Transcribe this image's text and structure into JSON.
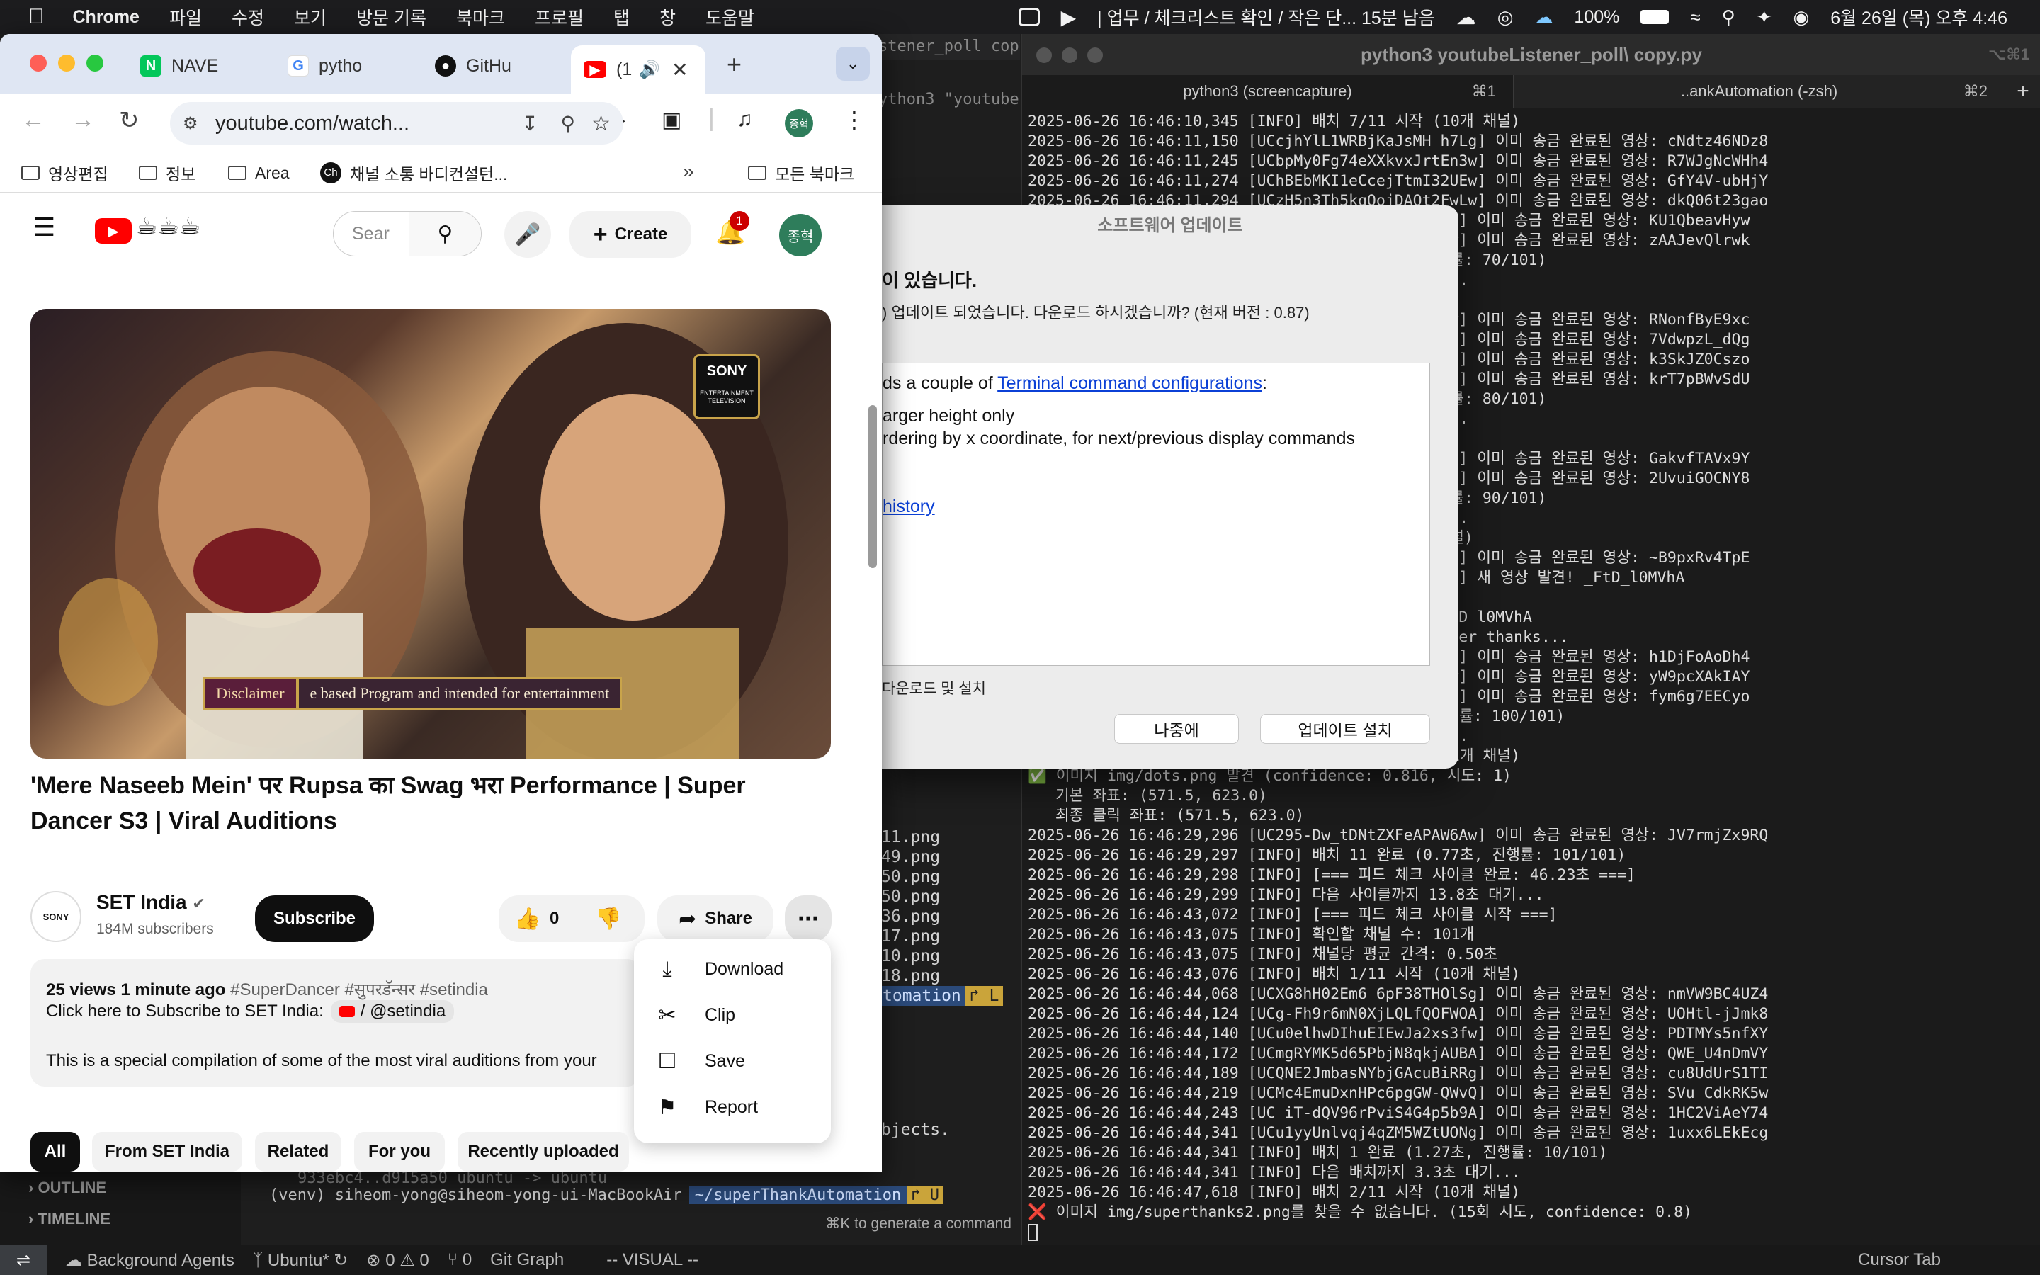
{
  "menubar": {
    "app": "Chrome",
    "items": [
      "파일",
      "수정",
      "보기",
      "방문 기록",
      "북마크",
      "프로필",
      "탭",
      "창",
      "도움말"
    ],
    "reminder": "업무 / 체크리스트 확인 / 작은 단... 15분 남음",
    "battery": "100%",
    "datetime": "6월 26일 (목) 오후 4:46"
  },
  "chrome": {
    "tabs": [
      {
        "label": "NAVE",
        "favicon": "N",
        "color": "#03c75a"
      },
      {
        "label": "pytho",
        "favicon": "G",
        "color": "#4285f4"
      },
      {
        "label": "GitHu",
        "favicon": "gh",
        "color": "#111111"
      },
      {
        "label": "(1",
        "favicon": "yt",
        "color": "#ff0000"
      }
    ],
    "url": "youtube.com/watch...",
    "profile_badge": "종혁",
    "bookmarks": [
      "영상편집",
      "정보",
      "Area",
      "채널 소통 바디컨설턴...",
      "모든 북마크"
    ]
  },
  "youtube": {
    "search_placeholder": "Sear",
    "create_label": "Create",
    "notif_count": "1",
    "avatar_label": "종혁",
    "video_title": "'Mere Naseeb Mein' पर Rupsa का Swag भरा Performance | Super Dancer S3 | Viral Auditions",
    "disclaimer_label": "Disclaimer",
    "disclaimer_text": "e based Program and intended for entertainment",
    "sony_logo": "SONY",
    "sony_sub": "ENTERTAINMENT TELEVISION",
    "channel_name": "SET India",
    "subscribers": "184M subscribers",
    "subscribe_label": "Subscribe",
    "like_count": "0",
    "share_label": "Share",
    "desc_meta": "25 views  1 minute ago",
    "desc_tags": "#SuperDancer #सुपरडॅन्सर #setindia",
    "desc_subscribe": "Click here to Subscribe to SET India:",
    "desc_handle": "/ @setindia",
    "desc_body": "This is a special compilation of some of the most viral auditions from your",
    "menu": [
      "Download",
      "Clip",
      "Save",
      "Report"
    ],
    "chips": [
      "All",
      "From SET India",
      "Related",
      "For you",
      "Recently uploaded"
    ]
  },
  "dialog": {
    "title": "소프트웨어 업데이트",
    "heading": "이 있습니다.",
    "message": ") 업데이트 되었습니다. 다운로드 하시겠습니까? (현재 버전 : 0.87)",
    "notes_line1_pre": "ds a couple of ",
    "notes_line1_link": "Terminal command configurations",
    "notes_line1_post": ":",
    "notes_line2": "arger height only",
    "notes_line3": "rdering by x coordinate, for next/previous display commands",
    "notes_link2": "history",
    "check_label": "다운로드 및 설치",
    "later_button": "나중에",
    "install_button": "업데이트 설치"
  },
  "terminal": {
    "title": "python3 youtubeListener_poll\\ copy.py",
    "title_shortcut": "⌥⌘1",
    "tab1": "python3 (screencapture)",
    "tab1_sc": "⌘1",
    "tab2": "..ankAutomation (-zsh)",
    "tab2_sc": "⌘2",
    "lines": [
      "2025-06-26 16:46:10,345 [INFO] 배치 7/11 시작 (10개 채널)",
      "2025-06-26 16:46:11,150 [UCcjhYlL1WRBjKaJsMH_h7Lg] 이미 송금 완료된 영상: cNdtz46NDz8",
      "2025-06-26 16:46:11,245 [UCbpMy0Fg74eXXkvxJrtEn3w] 이미 송금 완료된 영상: R7WJgNcWHh4",
      "2025-06-26 16:46:11,274 [UChBEbMKI1eCcejTtmI32UEw] 이미 송금 완료된 영상: GfY4V-ubHjY",
      "2025-06-26 16:46:11,294 [UCzH5n3Th5kqOojDAQt2FwLw] 이미 송금 완료된 영상: dkQ06t23gao",
      "                                          3CQ3Q] 이미 송금 완료된 영상: KU1QbeavHyw",
      "                                          STQNw] 이미 송금 완료된 영상: zAAJevQlrwk",
      "                                           진행률: 70/101)",
      "                                          대기...",
      "                                           채널)",
      "                                          0Tunw] 이미 송금 완료된 영상: RNonfByE9xc",
      "                                          5CYPA] 이미 송금 완료된 영상: 7VdwpzL_dQg",
      "                                          a4tdg] 이미 송금 완료된 영상: k3SkJZ0Cszo",
      "                                          VBKvQ] 이미 송금 완료된 영상: krT7pBWvSdU",
      "                                           진행률: 80/101)",
      "                                          대기...",
      "                                           채널)",
      "                                          waiBA] 이미 송금 완료된 영상: GakvfTAVx9Y",
      "                                          yjudA] 이미 송금 완료된 영상: 2UvuiGOCNY8",
      "                                           진행률: 90/101)",
      "                                          대기...",
      "                                          개 채널)",
      "                                          ms2LA] 이미 송금 완료된 영상: ~B9pxRv4TpE",
      "                                          AHD7Q] 새 영상 발견! _FtD_l0MVhA",
      "                                          시작",
      "                                          : _FtD_l0MVhA",
      "                                          g super thanks...",
      "                                          4_brA] 이미 송금 완료된 영상: h1DjFoAoDh4",
      "                                          JbuZw] 이미 송금 완료된 영상: yW9pcXAkIAY",
      "                                          u57UQ] 이미 송금 완료된 영상: fym6g7EECyo",
      "                                          , 진행률: 100/101)",
      "                                          대기...",
      "2025-06-26 16:46:28,527 [INFO] 배치 11/11 시작 (1개 채널)",
      "✅ 이미지 img/dots.png 발견 (confidence: 0.816, 시도: 1)",
      "   기본 좌표: (571.5, 623.0)",
      "   최종 클릭 좌표: (571.5, 623.0)",
      "2025-06-26 16:46:29,296 [UC295-Dw_tDNtZXFeAPAW6Aw] 이미 송금 완료된 영상: JV7rmjZx9RQ",
      "2025-06-26 16:46:29,297 [INFO] 배치 11 완료 (0.77초, 진행률: 101/101)",
      "2025-06-26 16:46:29,298 [INFO] [=== 피드 체크 사이클 완료: 46.23초 ===]",
      "2025-06-26 16:46:29,299 [INFO] 다음 사이클까지 13.8초 대기...",
      "2025-06-26 16:46:43,072 [INFO] [=== 피드 체크 사이클 시작 ===]",
      "2025-06-26 16:46:43,075 [INFO] 확인할 채널 수: 101개",
      "2025-06-26 16:46:43,075 [INFO] 채널당 평균 간격: 0.50초",
      "2025-06-26 16:46:43,076 [INFO] 배치 1/11 시작 (10개 채널)",
      "2025-06-26 16:46:44,068 [UCXG8hH02Em6_6pF38THOlSg] 이미 송금 완료된 영상: nmVW9BC4UZ4",
      "2025-06-26 16:46:44,124 [UCg-Fh9r6mN0XjLQLfQOFWOA] 이미 송금 완료된 영상: UOHtl-jJmk8",
      "2025-06-26 16:46:44,140 [UCu0elhwDIhuEIEwJa2xs3fw] 이미 송금 완료된 영상: PDTMYs5nfXY",
      "2025-06-26 16:46:44,172 [UCmgRYMK5d65PbjN8qkjAUBA] 이미 송금 완료된 영상: QWE_U4nDmVY",
      "2025-06-26 16:46:44,189 [UCQNE2JmbasNYbjGAcuBiRRg] 이미 송금 완료된 영상: cu8UdUrS1TI",
      "2025-06-26 16:46:44,219 [UCMc4EmuDxnHPc6pgGW-QWvQ] 이미 송금 완료된 영상: SVu_CdkRK5w",
      "2025-06-26 16:46:44,243 [UC_iT-dQV96rPviS4G4p5b9A] 이미 송금 완료된 영상: 1HC2ViAeY74",
      "2025-06-26 16:46:44,341 [UCu1yyUnlvqj4qZM5WZtUONg] 이미 송금 완료된 영상: 1uxx6LEkEcg",
      "2025-06-26 16:46:44,341 [INFO] 배치 1 완료 (1.27초, 진행률: 10/101)",
      "2025-06-26 16:46:44,341 [INFO] 다음 배치까지 3.3초 대기...",
      "2025-06-26 16:46:47,618 [INFO] 배치 2/11 시작 (10개 채널)",
      "❌ 이미지 img/superthanks2.png를 찾을 수 없습니다. (15회 시도, confidence: 0.8)"
    ]
  },
  "vscode": {
    "png_lines": [
      "11.png",
      "49.png",
      "50.png",
      "50.png",
      "36.png",
      "17.png",
      "10.png",
      "18.png"
    ],
    "automation_tag": "tomation",
    "objects_line": "bjects.",
    "bottom_line1": "933ebc4..d915a50  ubuntu -> ubuntu",
    "bottom_prompt": "(venv) siheom-yong@siheom-yong-ui-MacBookAir",
    "bottom_path": "~/superThankAutomation",
    "generate_hint": "⌘K to generate a command",
    "outline": "OUTLINE",
    "timeline": "TIMELINE",
    "status": [
      "Background Agents",
      "Ubuntu*",
      "⊗ 0 ⚠ 0",
      "⑂ 0",
      "Git Graph",
      "-- VISUAL --",
      "Cursor Tab"
    ]
  }
}
